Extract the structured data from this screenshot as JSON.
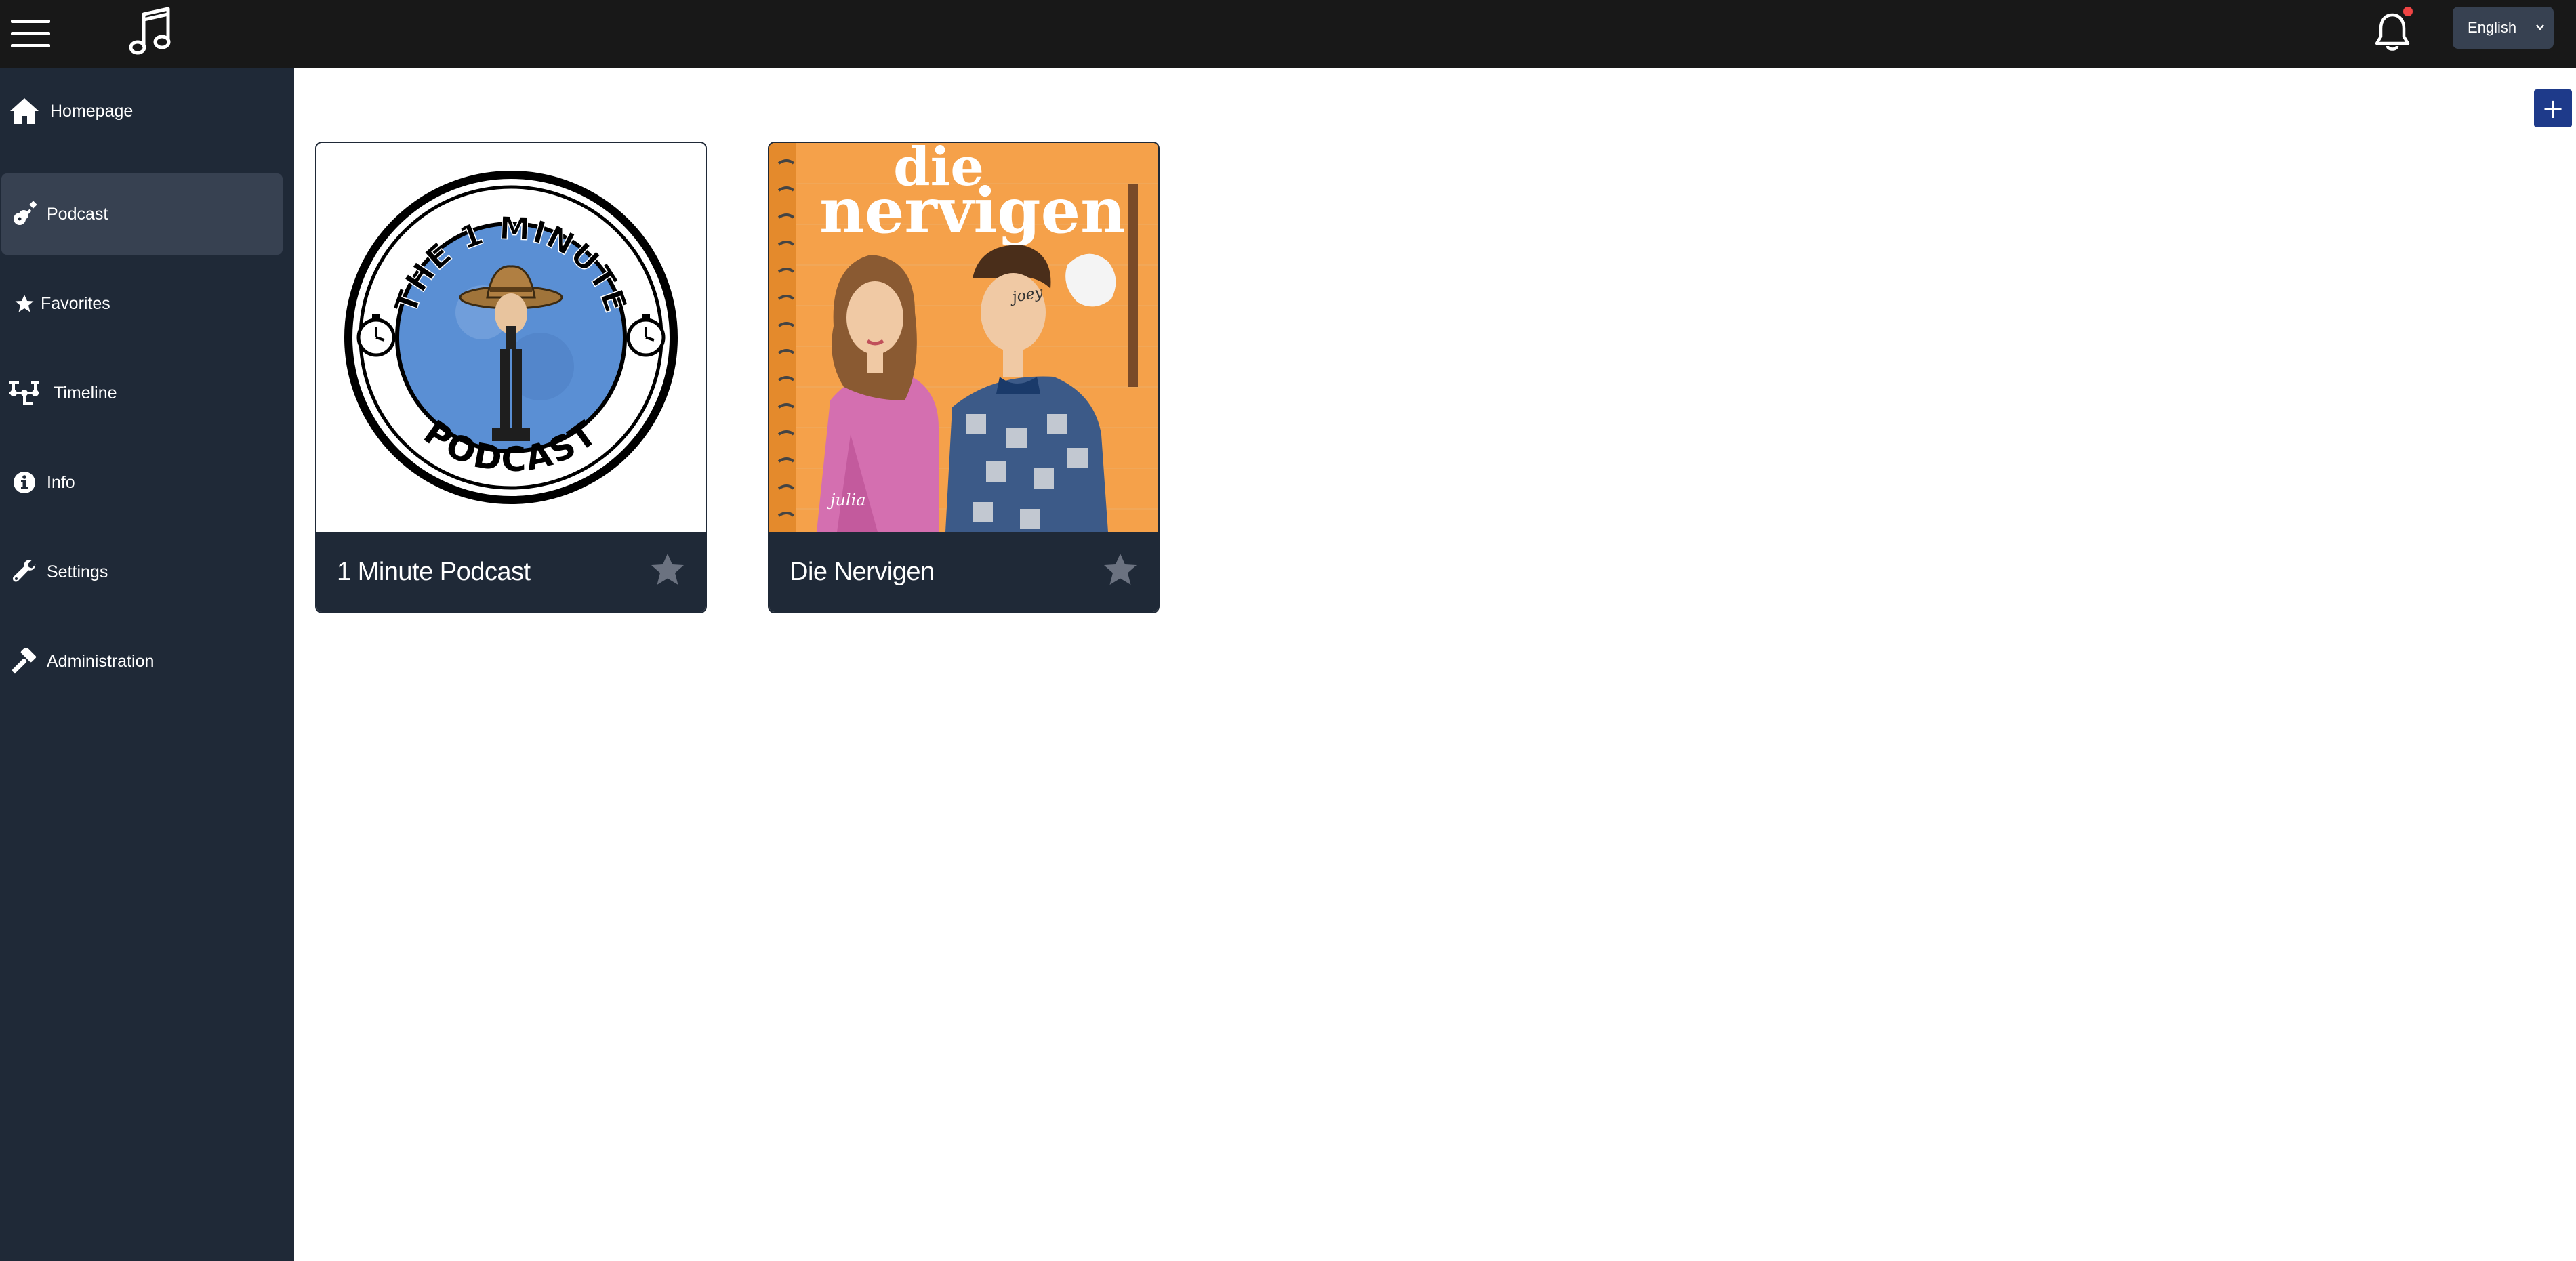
{
  "colors": {
    "topbar": "#181818",
    "sidebar": "#1f2937",
    "sidebar_active": "#374151",
    "card_footer": "#1f2937",
    "accent": "#1e3a8a",
    "notification_dot": "#ef4444",
    "star_inactive": "#6b7280",
    "lang_select_bg": "#374151"
  },
  "header": {
    "menu_icon": "hamburger-icon",
    "logo_icon": "music-note-icon",
    "notifications_icon": "bell-icon",
    "language": "English"
  },
  "sidebar": {
    "items": [
      {
        "label": "Homepage",
        "icon": "home-icon",
        "active": false
      },
      {
        "label": "Podcast",
        "icon": "guitar-icon",
        "active": true
      },
      {
        "label": "Favorites",
        "icon": "star-icon",
        "active": false
      },
      {
        "label": "Timeline",
        "icon": "timeline-icon",
        "active": false
      },
      {
        "label": "Info",
        "icon": "info-icon",
        "active": false
      },
      {
        "label": "Settings",
        "icon": "wrench-icon",
        "active": false
      },
      {
        "label": "Administration",
        "icon": "hammer-icon",
        "active": false
      }
    ]
  },
  "main": {
    "add_label": "+",
    "podcasts": [
      {
        "title": "1 Minute Podcast",
        "cover_text_top": "THE 1 MINUTE",
        "cover_text_bottom": "PODCAST",
        "favorite": false
      },
      {
        "title": "Die Nervigen",
        "cover_text_top": "die",
        "cover_text_bottom": "nervigen",
        "cover_sign_left": "julia",
        "cover_sign_right": "joey",
        "favorite": false
      }
    ]
  }
}
